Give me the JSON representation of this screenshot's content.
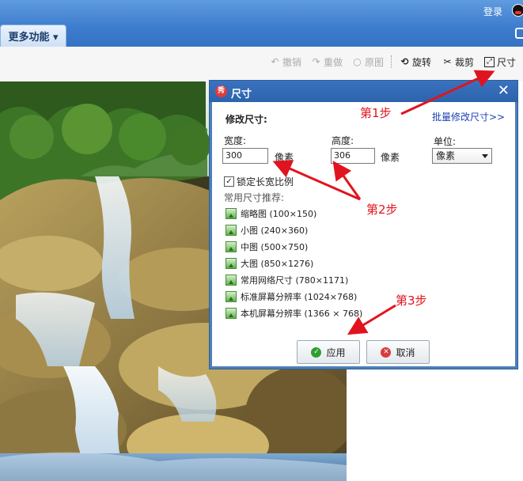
{
  "header": {
    "login_label": "登录",
    "more_functions_label": "更多功能 ▾"
  },
  "toolbar": {
    "undo_label": "撤销",
    "redo_label": "重做",
    "original_label": "原图",
    "rotate_label": "旋转",
    "crop_label": "裁剪",
    "size_label": "尺寸"
  },
  "dialog": {
    "title": "尺寸",
    "logo_text": "秀",
    "section_title": "修改尺寸:",
    "batch_link": "批量修改尺寸>>",
    "width_label": "宽度:",
    "width_value": "300",
    "width_unit": "像素",
    "height_label": "高度:",
    "height_value": "306",
    "height_unit": "像素",
    "unit_label": "单位:",
    "unit_selected": "像素",
    "lock_ratio_label": "锁定长宽比例",
    "lock_ratio_checked": true,
    "presets_title": "常用尺寸推荐:",
    "presets": [
      "缩略图 (100×150)",
      "小图 (240×360)",
      "中图 (500×750)",
      "大图 (850×1276)",
      "常用网络尺寸 (780×1171)",
      "标准屏幕分辨率 (1024×768)",
      "本机屏幕分辨率 (1366 × 768)"
    ],
    "apply_label": "应用",
    "cancel_label": "取消"
  },
  "annotations": {
    "step1": "第1步",
    "step2": "第2步",
    "step3": "第3步"
  },
  "colors": {
    "annotation": "#e0141e",
    "title_bar": "#2d63ad",
    "link": "#1a3fb8"
  }
}
